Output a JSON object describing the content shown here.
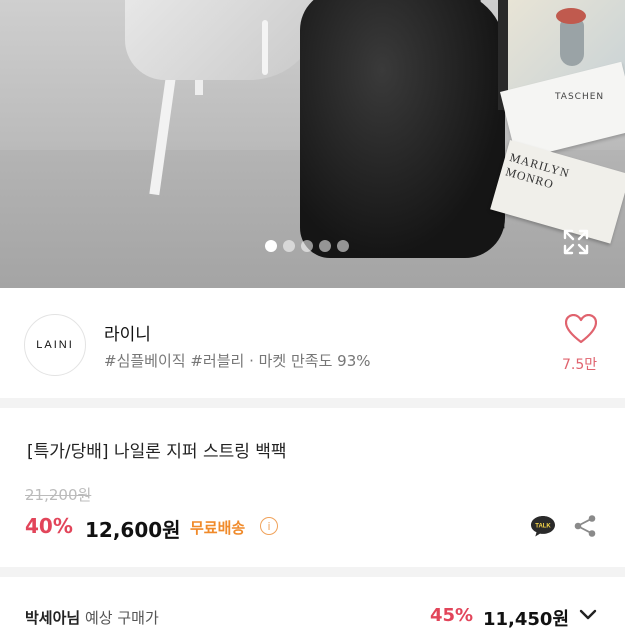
{
  "hero": {
    "book1_title": "TASCHEN",
    "book2_title": "MARILYN MONRO",
    "dots_total": 5,
    "dots_active_index": 0
  },
  "store": {
    "logo_text": "LAINI",
    "name": "라이니",
    "tags": "#심플베이직 #러블리 · 마켓 만족도 93%",
    "likes": "7.5만"
  },
  "product": {
    "title": "[특가/당배] 나일론 지퍼 스트링 백팩",
    "original_price": "21,200원",
    "discount": "40%",
    "price": "12,600원",
    "shipping": "무료배송",
    "info_symbol": "i"
  },
  "buyer": {
    "name": "박세아님",
    "label": " 예상 구매가",
    "discount": "45%",
    "price": "11,450원"
  },
  "colors": {
    "accent_pink": "#e2455a",
    "shipping_orange": "#f08a2a",
    "heart": "#e0636e"
  },
  "icons": [
    "expand-icon",
    "heart-icon",
    "kakaotalk-icon",
    "share-icon",
    "chevron-down-icon",
    "info-icon"
  ]
}
